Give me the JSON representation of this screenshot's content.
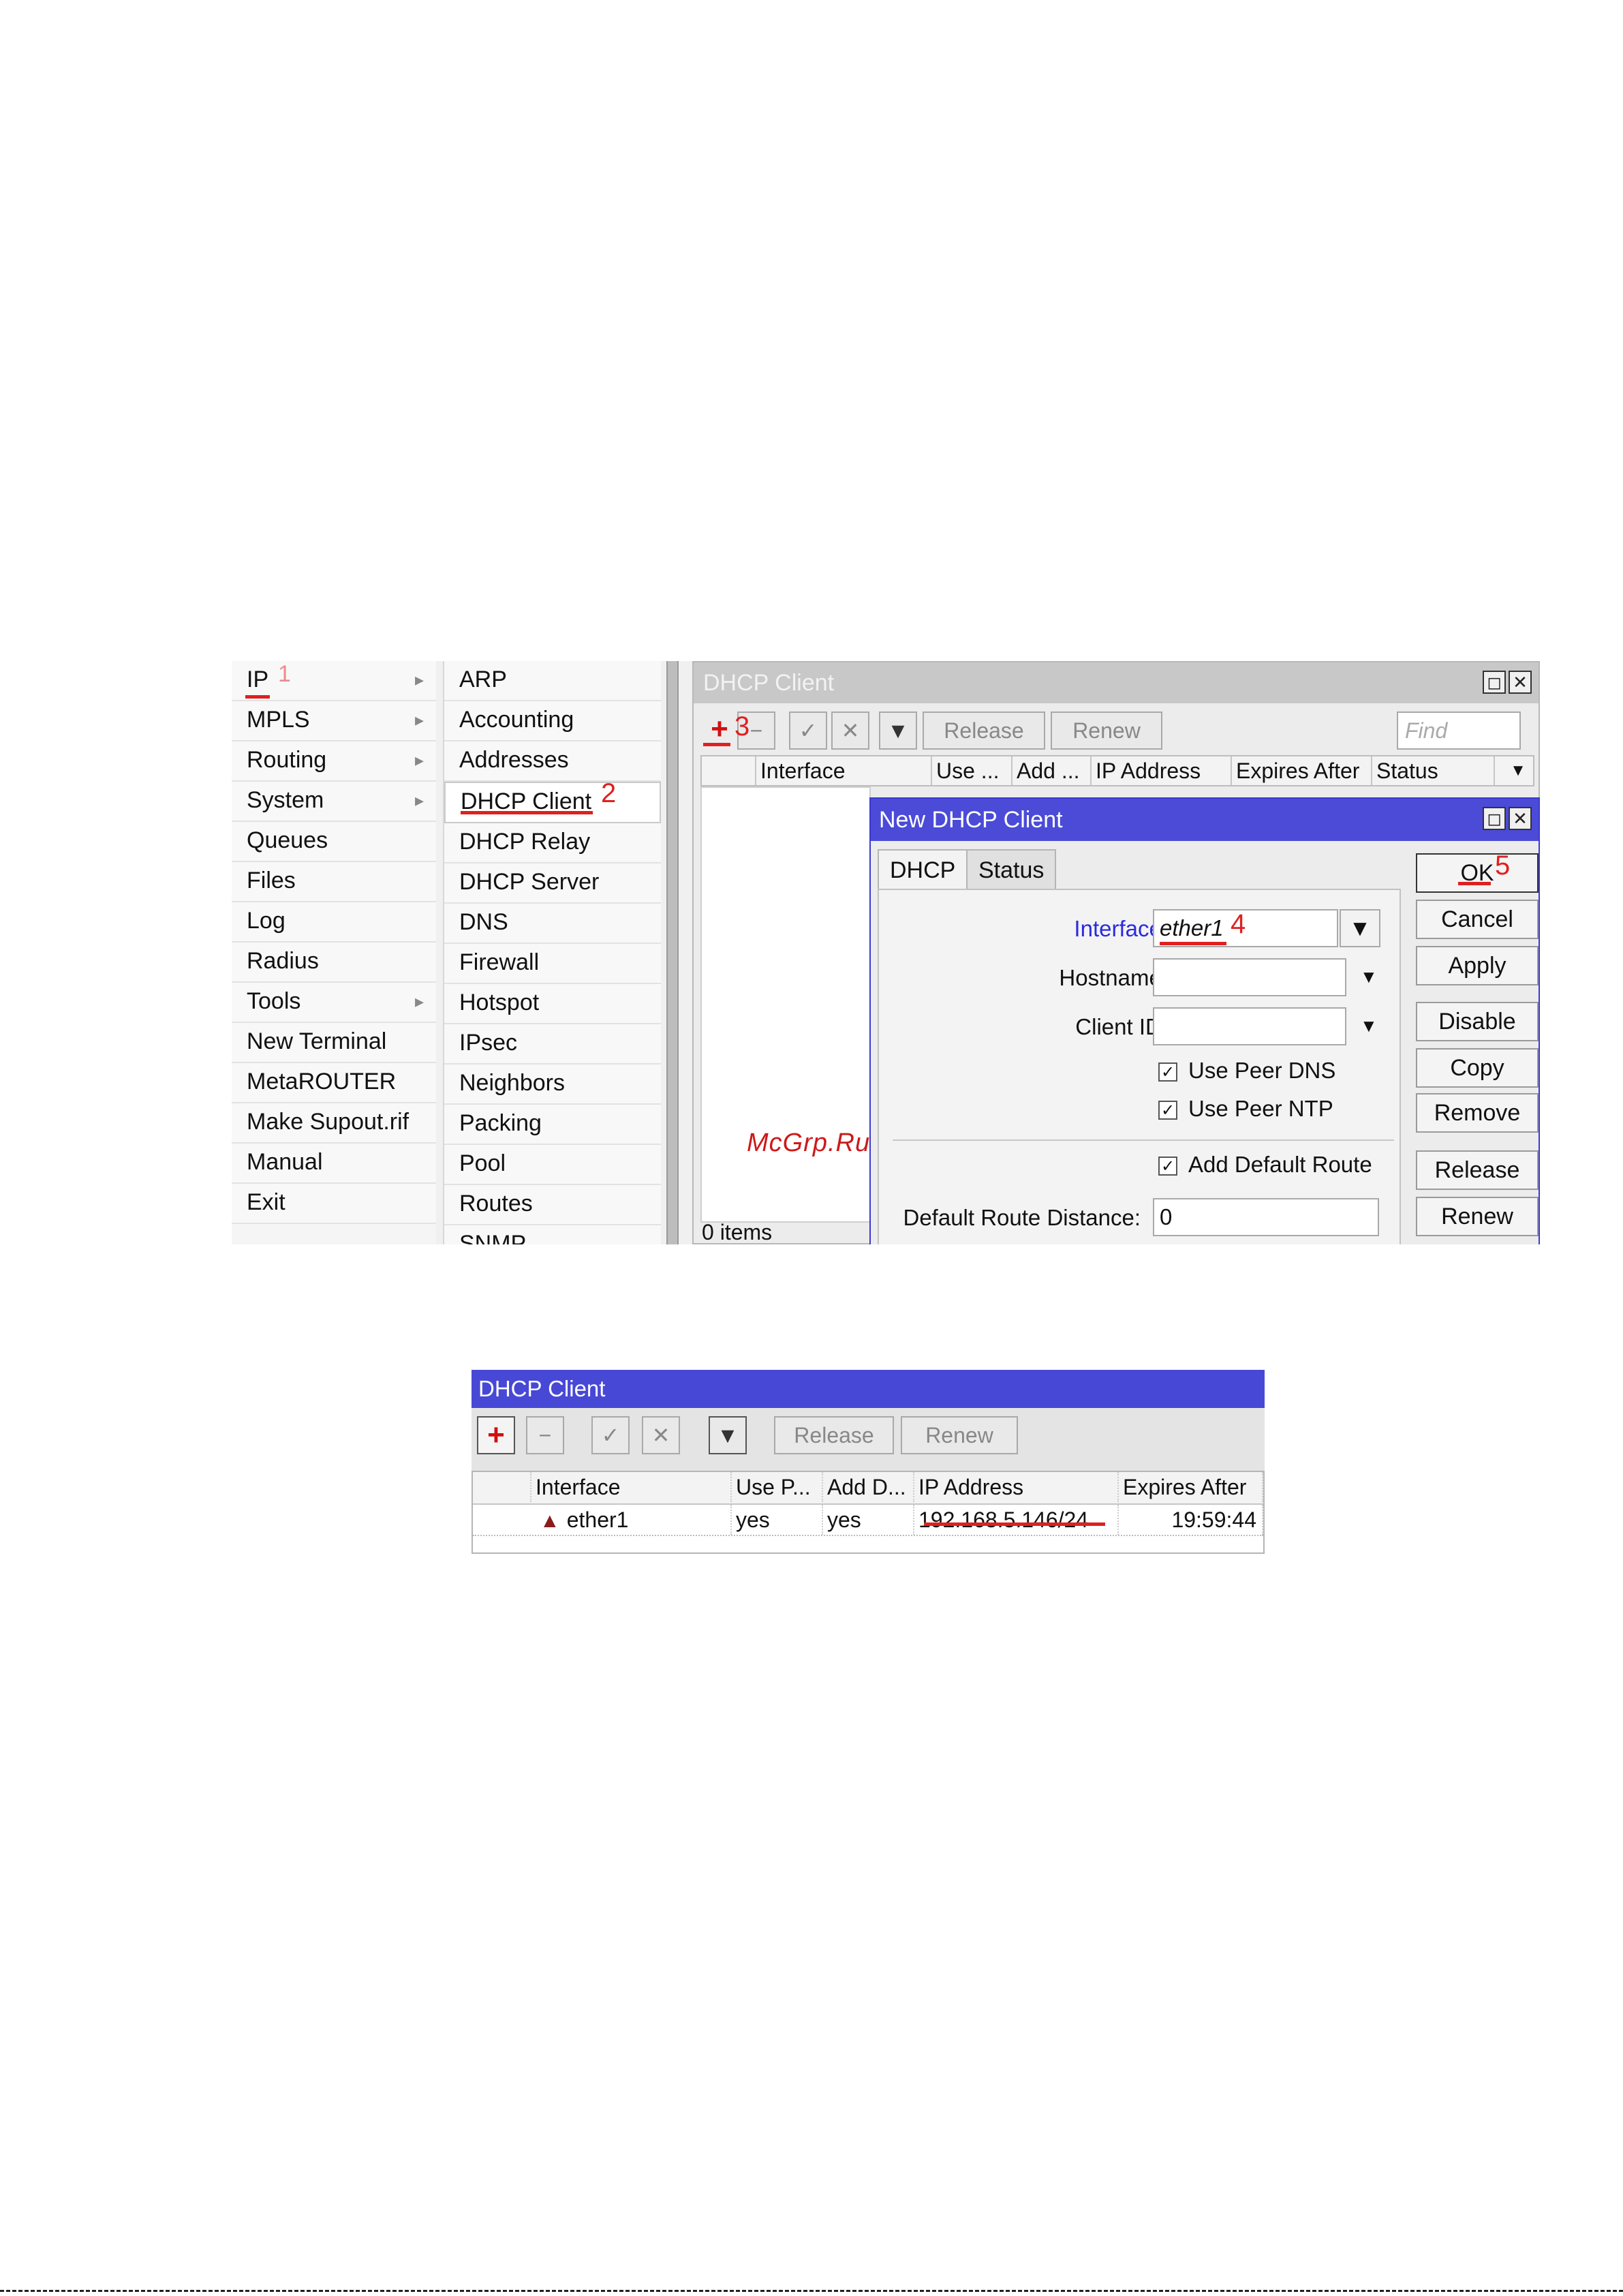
{
  "menu": {
    "main_items": [
      {
        "label": "IP",
        "submenu": true
      },
      {
        "label": "MPLS",
        "submenu": true
      },
      {
        "label": "Routing",
        "submenu": true
      },
      {
        "label": "System",
        "submenu": true
      },
      {
        "label": "Queues",
        "submenu": false
      },
      {
        "label": "Files",
        "submenu": false
      },
      {
        "label": "Log",
        "submenu": false
      },
      {
        "label": "Radius",
        "submenu": false
      },
      {
        "label": "Tools",
        "submenu": true
      },
      {
        "label": "New Terminal",
        "submenu": false
      },
      {
        "label": "MetaROUTER",
        "submenu": false
      },
      {
        "label": "Make Supout.rif",
        "submenu": false
      },
      {
        "label": "Manual",
        "submenu": false
      },
      {
        "label": "Exit",
        "submenu": false
      }
    ],
    "arrow_glyph": "▸",
    "ip_items": [
      "ARP",
      "Accounting",
      "Addresses",
      "DHCP Client",
      "DHCP Relay",
      "DHCP Server",
      "DNS",
      "Firewall",
      "Hotspot",
      "IPsec",
      "Neighbors",
      "Packing",
      "Pool",
      "Routes",
      "SNMP"
    ],
    "selected_ip_item": "DHCP Client"
  },
  "annotations": {
    "n1": "1",
    "n2": "2",
    "n3": "3",
    "n4": "4",
    "n5": "5",
    "color": "#e02020"
  },
  "dhcp_window": {
    "title": "DHCP Client",
    "toolbar": {
      "release": "Release",
      "renew": "Renew",
      "find_placeholder": "Find"
    },
    "columns": [
      "Interface",
      "Use ...",
      "Add ...",
      "IP Address",
      "Expires After",
      "Status"
    ],
    "items_count": "0 items"
  },
  "dialog": {
    "title": "New DHCP Client",
    "tabs": [
      "DHCP",
      "Status"
    ],
    "interface_label": "Interface:",
    "interface_value": "ether1",
    "hostname_label": "Hostname:",
    "client_id_label": "Client ID:",
    "use_peer_dns": "Use Peer DNS",
    "use_peer_ntp": "Use Peer NTP",
    "add_default_route": "Add Default Route",
    "default_route_distance_label": "Default Route Distance:",
    "default_route_distance_value": "0",
    "buttons": [
      "OK",
      "Cancel",
      "Apply",
      "Disable",
      "Copy",
      "Remove",
      "Release",
      "Renew"
    ],
    "accent": "#4b4bd8",
    "label_accent": "#2a2ae0"
  },
  "watermark": "McGrp.Ru",
  "result_window": {
    "title": "DHCP Client",
    "toolbar": {
      "release": "Release",
      "renew": "Renew"
    },
    "columns": [
      "Interface",
      "Use P...",
      "Add D...",
      "IP Address",
      "Expires After"
    ],
    "row": {
      "interface": "ether1",
      "use_peer": "yes",
      "add_default": "yes",
      "ip_address": "192.168.5.146/24",
      "expires_after": "19:59:44"
    }
  },
  "icons": [
    "plus-icon",
    "minus-icon",
    "check-icon",
    "cross-icon",
    "filter-icon",
    "restore-icon",
    "close-icon",
    "dropdown-icon",
    "interface-status-icon"
  ]
}
